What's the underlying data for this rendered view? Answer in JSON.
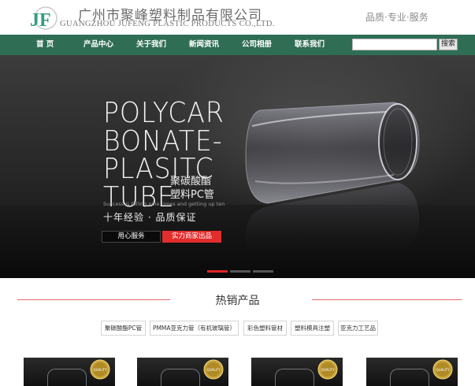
{
  "header": {
    "logo_text": "JF",
    "company_cn": "广州市聚峰塑料制品有限公司",
    "company_en": "GUANGZHOU JUFENG PLASTIC PRODUCTS CO.,LTD.",
    "slogan": "品质·专业·服务"
  },
  "nav": {
    "items": [
      "首 页",
      "产品中心",
      "关于我们",
      "新闻资讯",
      "公司相册",
      "联系我们"
    ],
    "search_value": "",
    "search_button": "搜索"
  },
  "banner": {
    "title": "POLYCAR\nBONATE-\nPLASITC\nTUBE",
    "title_cn": "聚碳酸酯\n塑料PC管",
    "small_text": "Success is falling nine times and getting up ten",
    "subtitle": "十年经验 · 品质保证",
    "button_service": "用心服务",
    "button_factory": "实力商家出品",
    "active_slide": 1,
    "slide_count": 3
  },
  "hot_products": {
    "title": "热销产品",
    "tags": [
      "聚碳酸酯PC管",
      "PMMA亚克力管（有机玻璃管）",
      "彩色塑料管材",
      "塑料模具注塑",
      "亚克力工艺品"
    ],
    "thumbs": [
      {
        "badge": "QUALITY"
      },
      {
        "badge": "QUALITY"
      },
      {
        "badge": "QUALITY"
      },
      {
        "badge": "QUALITY"
      }
    ]
  },
  "colors": {
    "nav_bg": "#2f6e55",
    "accent_red": "#e22d2d",
    "logo_green": "#2f9e7c"
  }
}
